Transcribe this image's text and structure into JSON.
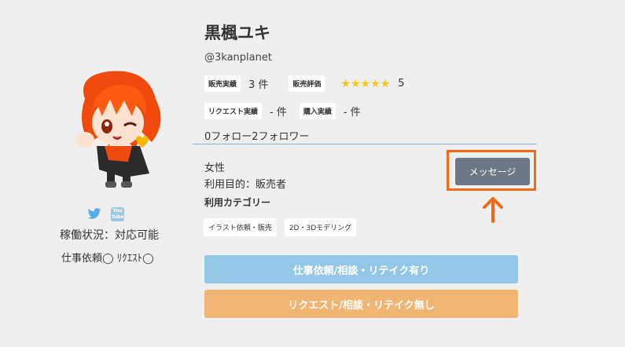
{
  "profile": {
    "name": "黒楓ユキ",
    "handle": "@3kanplanet",
    "sales_label": "販売実績",
    "sales_value": "3 件",
    "rating_label": "販売評価",
    "rating_stars": "★★★★★",
    "rating_value": "5",
    "request_label": "リクエスト実績",
    "request_value": "- 件",
    "purchase_label": "購入実績",
    "purchase_value": "- 件",
    "follow_text": "0フォロー2フォロワー",
    "gender": "女性",
    "purpose": "利用目的：販売者",
    "category_heading": "利用カテゴリー",
    "categories": [
      "イラスト依頼・販売",
      "2D・3Dモデリング"
    ]
  },
  "sidebar": {
    "status": "稼働状況：対応可能",
    "request_status": "仕事依頼◯ ﾘｸｴｽﾄ◯",
    "youtube_icon_text": [
      "You",
      "Tube"
    ]
  },
  "actions": {
    "message_label": "メッセージ",
    "job_request_label": "仕事依頼/相談・リテイク有り",
    "request_label": "リクエスト/相談・リテイク無し"
  },
  "colors": {
    "highlight": "#f06a1b",
    "message_button": "#6e7785",
    "job_button": "#92c7e8",
    "request_button": "#f0b473",
    "stars": "#f5c518"
  }
}
